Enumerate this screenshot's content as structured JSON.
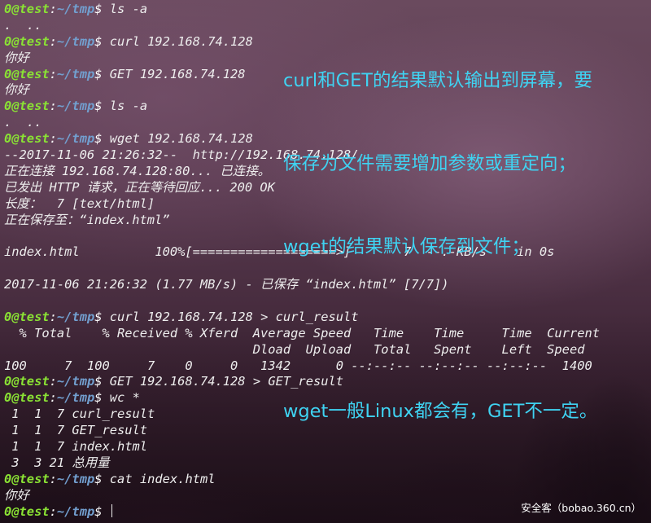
{
  "terminal": {
    "prompt_user": "0@test",
    "prompt_sep": ":",
    "prompt_path": "~/tmp",
    "prompt_dollar": "$",
    "lines": [
      {
        "type": "cmd",
        "text": " ls -a"
      },
      {
        "type": "out",
        "text": ".  .."
      },
      {
        "type": "cmd",
        "text": " curl 192.168.74.128"
      },
      {
        "type": "out",
        "text": "你好"
      },
      {
        "type": "cmd",
        "text": " GET 192.168.74.128"
      },
      {
        "type": "out",
        "text": "你好"
      },
      {
        "type": "cmd",
        "text": " ls -a"
      },
      {
        "type": "out",
        "text": ".  .."
      },
      {
        "type": "cmd",
        "text": " wget 192.168.74.128"
      },
      {
        "type": "out",
        "text": "--2017-11-06 21:26:32--  http://192.168.74.128/"
      },
      {
        "type": "out",
        "text": "正在连接 192.168.74.128:80... 已连接。"
      },
      {
        "type": "out",
        "text": "已发出 HTTP 请求，正在等待回应... 200 OK"
      },
      {
        "type": "out",
        "text": "长度：  7 [text/html]"
      },
      {
        "type": "out",
        "text": "正在保存至：“index.html”"
      },
      {
        "type": "out",
        "text": ""
      },
      {
        "type": "out",
        "text": "index.html          100%[===================>]       7  --.-KB/s    in 0s"
      },
      {
        "type": "out",
        "text": ""
      },
      {
        "type": "out",
        "text": "2017-11-06 21:26:32 (1.77 MB/s) - 已保存 “index.html” [7/7])"
      },
      {
        "type": "out",
        "text": ""
      },
      {
        "type": "cmd",
        "text": " curl 192.168.74.128 > curl_result"
      },
      {
        "type": "out",
        "text": "  % Total    % Received % Xferd  Average Speed   Time    Time     Time  Current"
      },
      {
        "type": "out",
        "text": "                                 Dload  Upload   Total   Spent    Left  Speed"
      },
      {
        "type": "out",
        "text": "100     7  100     7    0     0   1342      0 --:--:-- --:--:-- --:--:--  1400"
      },
      {
        "type": "cmd",
        "text": " GET 192.168.74.128 > GET_result"
      },
      {
        "type": "cmd",
        "text": " wc *"
      },
      {
        "type": "out",
        "text": " 1  1  7 curl_result"
      },
      {
        "type": "out",
        "text": " 1  1  7 GET_result"
      },
      {
        "type": "out",
        "text": " 1  1  7 index.html"
      },
      {
        "type": "out",
        "text": " 3  3 21 总用量"
      },
      {
        "type": "cmd",
        "text": " cat index.html"
      },
      {
        "type": "out",
        "text": "你好"
      },
      {
        "type": "cmd",
        "text": " ",
        "cursor": true
      }
    ]
  },
  "annotation": {
    "line1": "curl和GET的结果默认输出到屏幕，要",
    "line2": "保存为文件需要增加参数或重定向；",
    "line3": "wget的结果默认保存到文件；",
    "line4": "wget一般Linux都会有，GET不一定。",
    "color": "#3fd3f2"
  },
  "watermark": "安全客（bobao.360.cn）",
  "colors": {
    "prompt_user": "#8ae234",
    "prompt_path": "#729fcf",
    "text": "#eeeeee"
  }
}
